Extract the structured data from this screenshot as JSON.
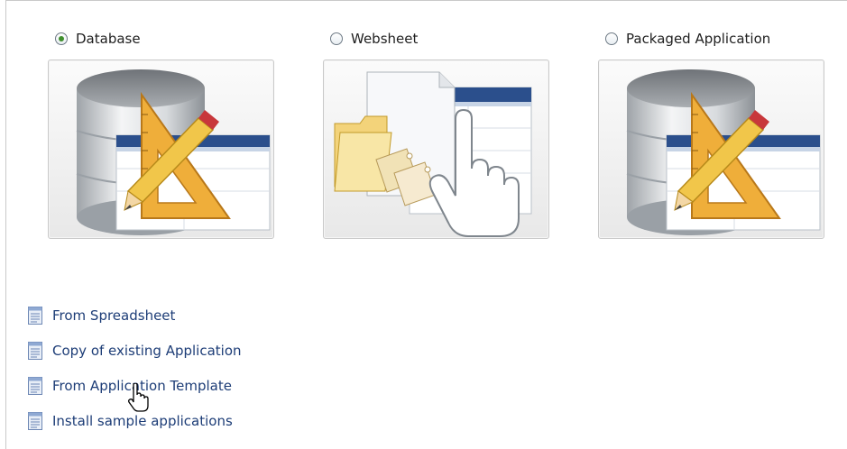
{
  "options": [
    {
      "label": "Database",
      "selected": true
    },
    {
      "label": "Websheet",
      "selected": false
    },
    {
      "label": "Packaged Application",
      "selected": false
    }
  ],
  "links": [
    {
      "label": "From Spreadsheet"
    },
    {
      "label": "Copy of existing Application"
    },
    {
      "label": "From Application Template"
    },
    {
      "label": "Install sample applications"
    }
  ],
  "icons": {
    "database": "database-design-icon",
    "websheet": "websheet-icon",
    "packaged": "packaged-application-icon",
    "link": "document-icon",
    "cursor": "hand-pointer-cursor-icon"
  },
  "colors": {
    "link": "#1d3d77",
    "radio_selected": "#3f8f2d",
    "tile_border": "#c9c9c9"
  }
}
